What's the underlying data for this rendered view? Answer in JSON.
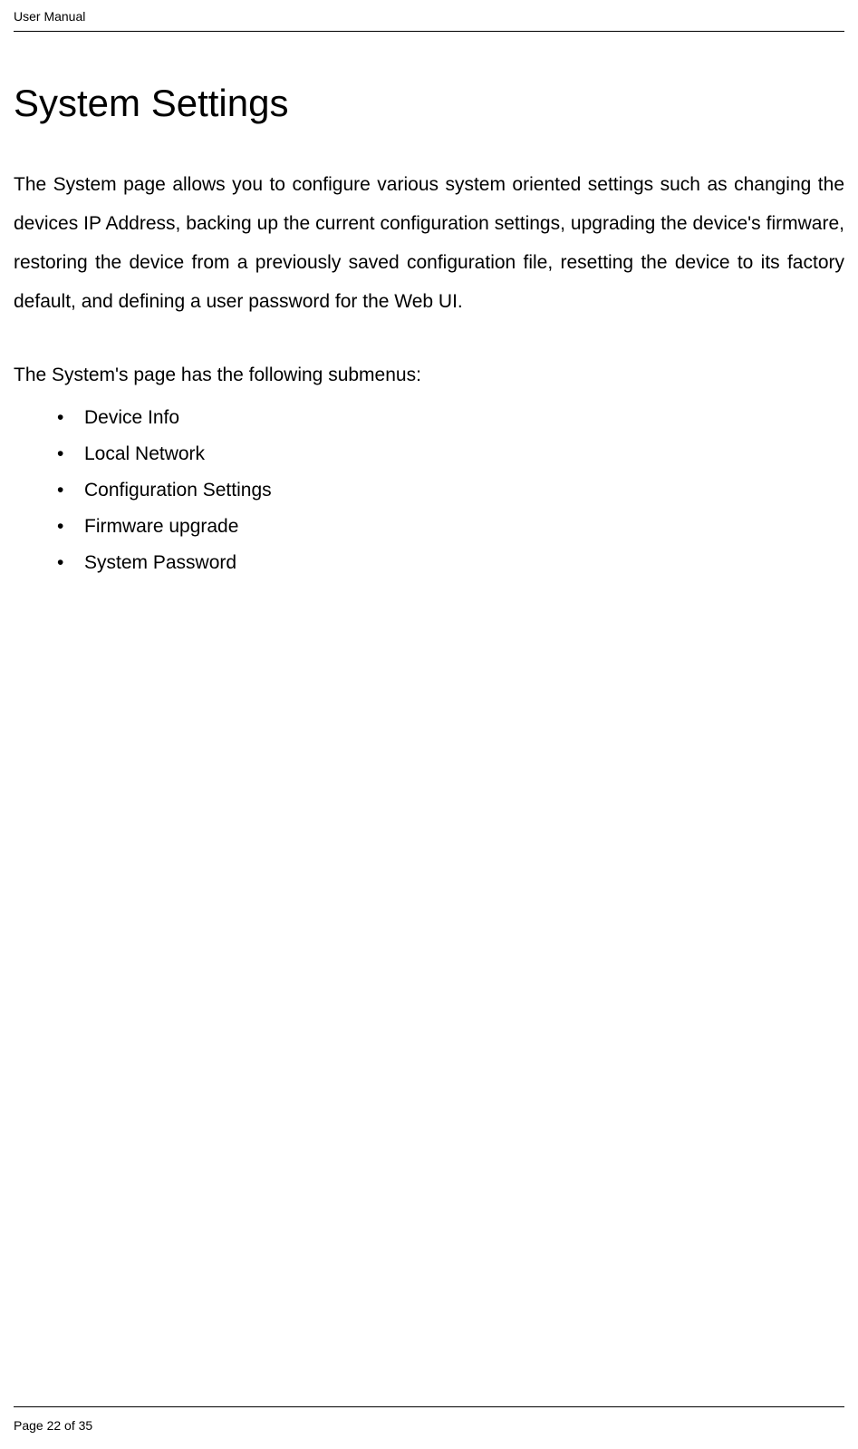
{
  "header": {
    "label": "User Manual"
  },
  "title": "System Settings",
  "intro": "The System page allows you to configure various system oriented settings such as changing the devices IP Address, backing up the current configuration settings, upgrading the device's  firmware, restoring the device from a previously saved configuration file, resetting the device to its factory default, and defining a user password for the Web UI.",
  "subheading": "The System's page has the following submenus:",
  "bullets": [
    "Device Info",
    "Local Network",
    "Configuration Settings",
    "Firmware upgrade",
    "System Password"
  ],
  "footer": {
    "page_label": "Page 22 of 35"
  }
}
